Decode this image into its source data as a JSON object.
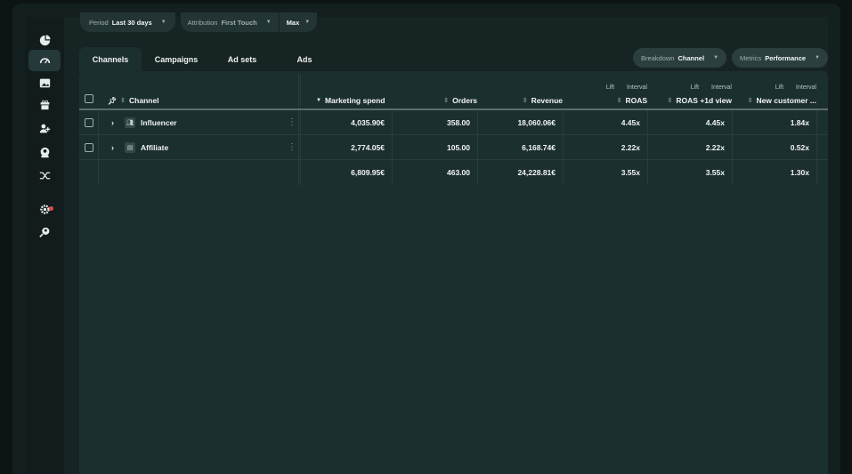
{
  "filters": {
    "period_label": "Period",
    "period_value": "Last 30 days",
    "attribution_label": "Attribution",
    "attribution_value": "First Touch",
    "window_value": "Max"
  },
  "tabs": [
    "Channels",
    "Campaigns",
    "Ad sets",
    "Ads"
  ],
  "breakdown": {
    "label": "Breakdown",
    "value": "Channel"
  },
  "metrics": {
    "label": "Metrics",
    "value": "Performance"
  },
  "table": {
    "headers": {
      "channel": "Channel",
      "spend": "Marketing spend",
      "orders": "Orders",
      "revenue": "Revenue",
      "roas": "ROAS",
      "roas1d": "ROAS +1d view",
      "newcust": "New customer ..."
    },
    "lift_label": "Lift",
    "interval_label": "Interval",
    "rows": [
      {
        "channel": "Influencer",
        "spend": "4,035.90€",
        "orders": "358.00",
        "revenue": "18,060.06€",
        "roas": "4.45x",
        "roas1d": "4.45x",
        "newcust": "1.84x"
      },
      {
        "channel": "Affiliate",
        "spend": "2,774.05€",
        "orders": "105.00",
        "revenue": "6,168.74€",
        "roas": "2.22x",
        "roas1d": "2.22x",
        "newcust": "0.52x"
      }
    ],
    "total": {
      "spend": "6,809.95€",
      "orders": "463.00",
      "revenue": "24,228.81€",
      "roas": "3.55x",
      "roas1d": "3.55x",
      "newcust": "1.30x"
    }
  },
  "icons": {
    "rail": [
      "pie-chart-icon",
      "dashboard-gauge-icon",
      "image-icon",
      "gift-icon",
      "add-user-icon",
      "user-badge-icon",
      "shuffle-icon",
      "settings-icon",
      "user-search-icon"
    ],
    "status_dot_color": "#e5484d"
  }
}
